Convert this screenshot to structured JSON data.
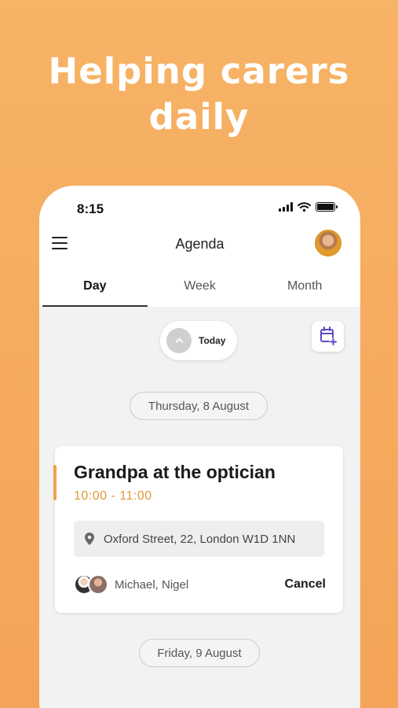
{
  "promo": {
    "headline_line1": "Helping carers",
    "headline_line2": "daily"
  },
  "status_bar": {
    "time": "8:15"
  },
  "header": {
    "title": "Agenda"
  },
  "tabs": [
    {
      "label": "Day",
      "active": true
    },
    {
      "label": "Week",
      "active": false
    },
    {
      "label": "Month",
      "active": false
    }
  ],
  "toolbar": {
    "today_label": "Today"
  },
  "agenda": {
    "day1": {
      "date": "Thursday, 8 August",
      "event": {
        "title": "Grandpa at the optician",
        "time": "10:00 - 11:00",
        "location": "Oxford Street, 22, London W1D 1NN",
        "attendees": "Michael, Nigel",
        "cancel_label": "Cancel"
      }
    },
    "day2": {
      "date": "Friday, 9 August"
    }
  },
  "colors": {
    "background": "#f4a457",
    "accent": "#e3993a",
    "calendar_icon": "#5b4bc4"
  },
  "icons": [
    "menu-icon",
    "avatar",
    "chevron-up-icon",
    "calendar-add-icon",
    "location-pin-icon",
    "signal-icon",
    "wifi-icon",
    "battery-icon"
  ]
}
